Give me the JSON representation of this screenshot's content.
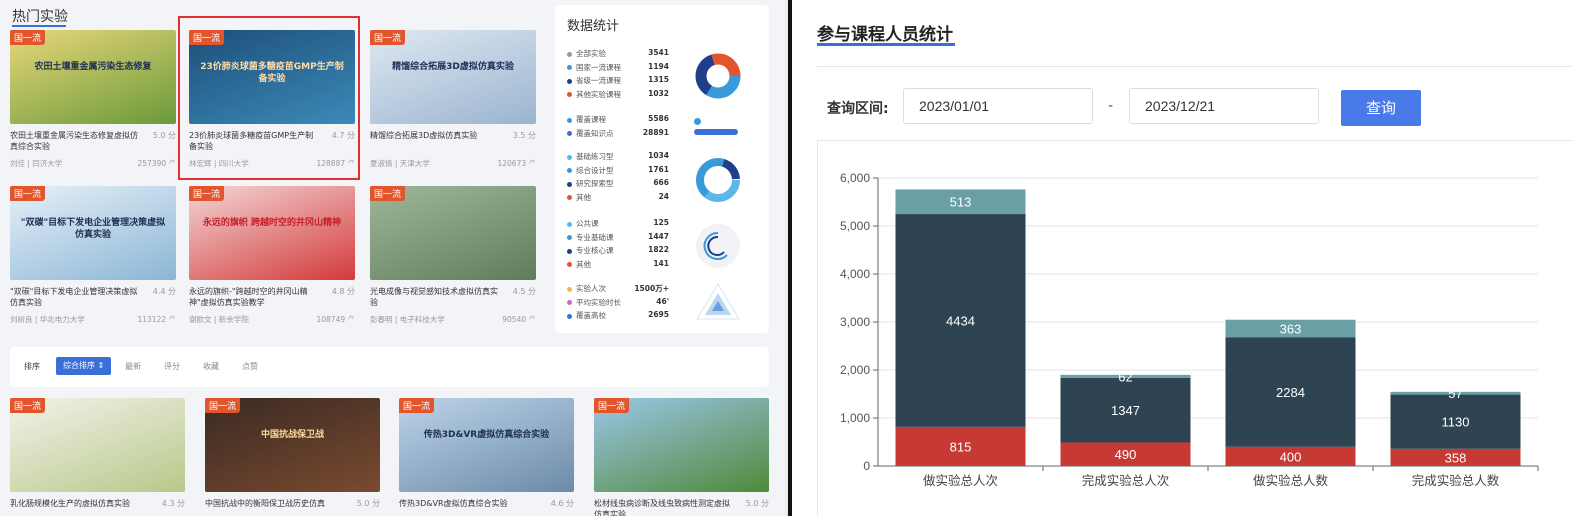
{
  "left": {
    "hot_title": "热门实验",
    "cards": [
      {
        "badge": "国一流",
        "title": "农田土壤重金属污染生态修复虚拟仿真综合实验",
        "score": "5.0 分",
        "author": "刘佳 | 同济大学",
        "count": "257390 ⺈",
        "thumb_text": "农田土壤重金属污染生态修复",
        "colors": [
          "#e8d77a",
          "#6a9a3a"
        ]
      },
      {
        "badge": "国一流",
        "title": "23价肺炎球菌多糖疫苗GMP生产制备实验",
        "score": "4.7 分",
        "author": "林宏辉 | 四川大学",
        "count": "128887 ⺈",
        "thumb_text": "23价肺炎球菌多糖疫苗GMP生产制备实验",
        "colors": [
          "#1e4f7a",
          "#3b8ab8"
        ],
        "selected": true
      },
      {
        "badge": "国一流",
        "title": "精馏综合拓展3D虚拟仿真实验",
        "score": "3.5 分",
        "author": "夏淑倩 | 天津大学",
        "count": "120673 ⺈",
        "thumb_text": "精馏综合拓展3D虚拟仿真实验",
        "colors": [
          "#dfe8f2",
          "#9ab4cf"
        ]
      },
      {
        "badge": "国一流",
        "title": "\"双碳\"目标下发电企业管理决策虚拟仿真实验",
        "score": "4.4 分",
        "author": "刘树良 | 华北电力大学",
        "count": "113122 ⺈",
        "thumb_text": "\"双碳\"目标下发电企业管理决策虚拟仿真实验",
        "colors": [
          "#e6f0f7",
          "#8bb6d6"
        ]
      },
      {
        "badge": "国一流",
        "title": "永远的旗帜-\"跨越时空的井冈山精神\"虚拟仿真实验教学",
        "score": "4.8 分",
        "author": "谢欧文 | 新余学院",
        "count": "108749 ⺈",
        "thumb_text": "永远的旗帜 跨越时空的井冈山精神",
        "colors": [
          "#f3d6d6",
          "#d43a3a"
        ]
      },
      {
        "badge": "国一流",
        "title": "光电成像与视觉感知技术虚拟仿真实验",
        "score": "4.5 分",
        "author": "彭春明 | 电子科技大学",
        "count": "90540 ⺈",
        "thumb_text": "",
        "colors": [
          "#9fb79a",
          "#5f7d5a"
        ]
      },
      {
        "badge": "国一流",
        "title": "乳化肠规模化生产的虚拟仿真实验",
        "score": "4.3 分",
        "thumb_text": "",
        "colors": [
          "#f2f2ea",
          "#b8c88a"
        ]
      },
      {
        "badge": "国一流",
        "title": "中国抗战中的衡阳保卫战历史仿真",
        "score": "5.0 分",
        "thumb_text": "中国抗战保卫战",
        "colors": [
          "#3a2a22",
          "#7a4a30"
        ]
      },
      {
        "badge": "国一流",
        "title": "传热3D&VR虚拟仿真综合实验",
        "score": "4.6 分",
        "thumb_text": "传热3D&VR虚拟仿真综合实验",
        "colors": [
          "#bcd4ea",
          "#6c8aa8"
        ]
      },
      {
        "badge": "国一流",
        "title": "松材线虫病诊断及线虫致病性测定虚拟仿真实验",
        "score": "5.0 分",
        "thumb_text": "",
        "colors": [
          "#9cc6e8",
          "#4f8a3a"
        ]
      }
    ],
    "stats": {
      "title": "数据统计",
      "groups": [
        [
          {
            "label": "全部实验",
            "value": "3541",
            "color": "#999999"
          },
          {
            "label": "国家一流课程",
            "value": "1194",
            "color": "#3a9ad9"
          },
          {
            "label": "省级一流课程",
            "value": "1315",
            "color": "#1f3f8a"
          },
          {
            "label": "其他实验课程",
            "value": "1032",
            "color": "#e2562e"
          }
        ],
        [
          {
            "label": "覆盖课程",
            "value": "5586",
            "color": "#3a9ad9"
          },
          {
            "label": "覆盖知识点",
            "value": "28891",
            "color": "#3b6fd8"
          }
        ],
        [
          {
            "label": "基础练习型",
            "value": "1034",
            "color": "#5ab8e8"
          },
          {
            "label": "综合设计型",
            "value": "1761",
            "color": "#3a9ad9"
          },
          {
            "label": "研究探索型",
            "value": "666",
            "color": "#1f3f8a"
          },
          {
            "label": "其他",
            "value": "24",
            "color": "#e2562e"
          }
        ],
        [
          {
            "label": "公共课",
            "value": "125",
            "color": "#5ab8e8"
          },
          {
            "label": "专业基础课",
            "value": "1447",
            "color": "#3a9ad9"
          },
          {
            "label": "专业核心课",
            "value": "1822",
            "color": "#1f3f8a"
          },
          {
            "label": "其他",
            "value": "141",
            "color": "#e2562e"
          }
        ],
        [
          {
            "label": "实验人次",
            "value": "1500万+",
            "color": "#f2b84a"
          },
          {
            "label": "平均实验时长",
            "value": "46'",
            "color": "#c56ad0"
          },
          {
            "label": "覆盖高校",
            "value": "2695",
            "color": "#3b6fd8"
          }
        ]
      ]
    },
    "sort": {
      "label": "排序",
      "active": "综合排序 ⇕",
      "items": [
        "最新",
        "评分",
        "收藏",
        "点赞"
      ]
    }
  },
  "right": {
    "title": "参与课程人员统计",
    "query_label": "查询区间:",
    "start_date": "2023/01/01",
    "dash": "-",
    "end_date": "2023/12/21",
    "query_button": "查询"
  },
  "chart_data": {
    "type": "bar",
    "stacked": true,
    "categories": [
      "做实验总人次",
      "完成实验总人次",
      "做实验总人数",
      "完成实验总人数"
    ],
    "series": [
      {
        "values": [
          815,
          490,
          400,
          358
        ],
        "color": "#c73a34"
      },
      {
        "values": [
          4434,
          1347,
          2284,
          1130
        ],
        "color": "#2e4453"
      },
      {
        "values": [
          513,
          62,
          363,
          57
        ],
        "color": "#6a9fa6"
      }
    ],
    "ylim": [
      0,
      6000
    ],
    "yticks": [
      "0",
      "1,000",
      "2,000",
      "3,000",
      "4,000",
      "5,000",
      "6,000"
    ],
    "grid": true
  }
}
